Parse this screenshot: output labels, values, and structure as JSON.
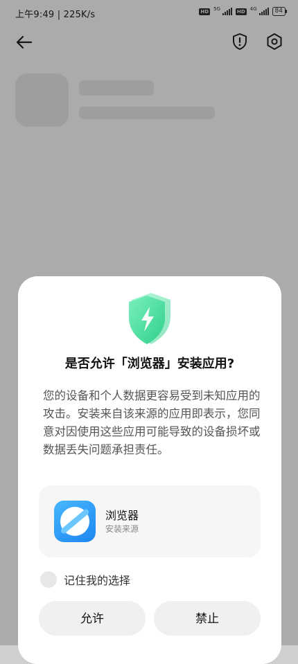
{
  "status_bar": {
    "time_speed": "上午9:49 | 225K/s",
    "sim1_tag": "HD",
    "sim1_net": "5G",
    "sim2_tag": "HD",
    "sim2_net": "4G",
    "battery": "84"
  },
  "toolbar": {
    "back_icon": "arrow-left-icon",
    "security_icon": "shield-alert-icon",
    "settings_icon": "gear-icon"
  },
  "dialog": {
    "title": "是否允许「浏览器」安装应用?",
    "body": "您的设备和个人数据更容易受到未知应用的攻击。安装来自该来源的应用即表示，您同意对因使用这些应用可能导致的设备损坏或数据丢失问题承担责任。",
    "app": {
      "name": "浏览器",
      "subtitle": "安装来源"
    },
    "remember_label": "记住我的选择",
    "allow_label": "允许",
    "deny_label": "禁止"
  },
  "colors": {
    "shield_green": "#3ddc97",
    "app_icon_blue": "#2c95f5"
  }
}
